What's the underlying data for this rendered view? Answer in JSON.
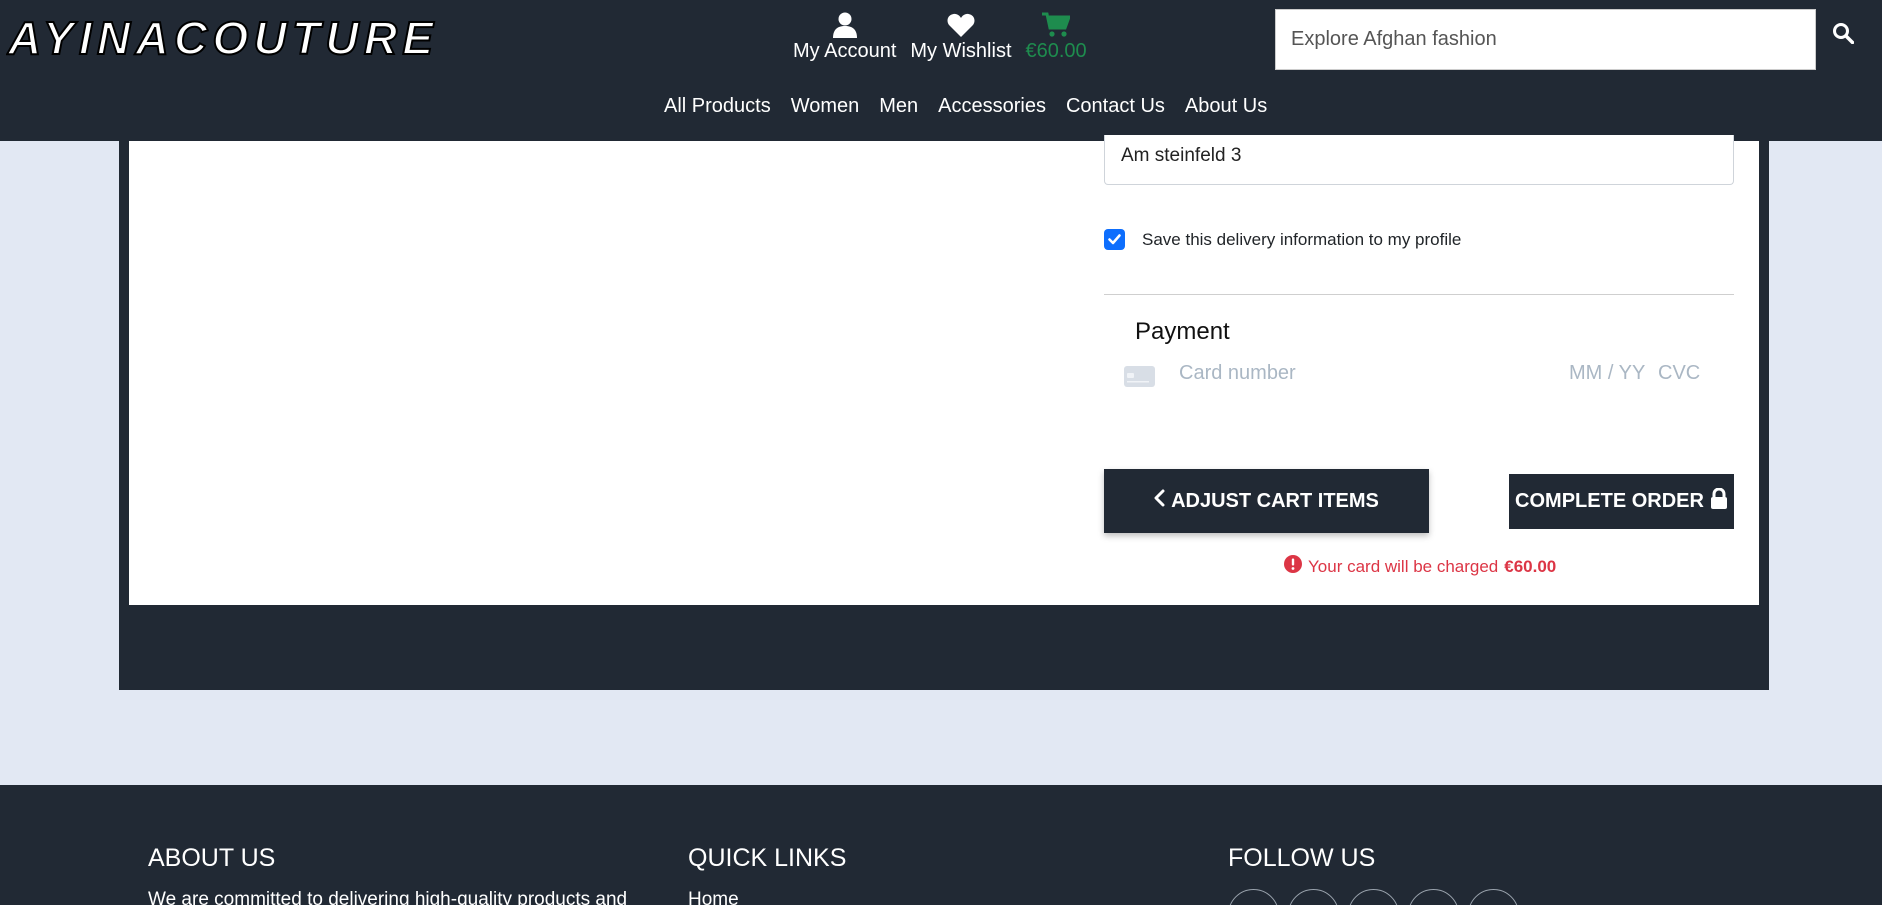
{
  "header": {
    "logo_text": "AYINACOUTURE",
    "account_label": "My Account",
    "wishlist_label": "My Wishlist",
    "cart_total": "€60.00",
    "search_placeholder": "Explore Afghan fashion"
  },
  "nav": {
    "items": [
      "All Products",
      "Women",
      "Men",
      "Accessories",
      "Contact Us",
      "About Us"
    ]
  },
  "checkout": {
    "address_value": "Am steinfeld 3",
    "save_info_label": "Save this delivery information to my profile",
    "save_info_checked": true,
    "payment_title": "Payment",
    "card_number_placeholder": "Card number",
    "expiry_placeholder": "MM / YY",
    "cvc_placeholder": "CVC",
    "adjust_button": "ADJUST CART ITEMS",
    "complete_button": "COMPLETE ORDER",
    "charge_notice": "Your card will be charged",
    "charge_amount": "€60.00"
  },
  "footer": {
    "about_title": "ABOUT US",
    "about_text": "We are committed to delivering high-quality products and",
    "links_title": "QUICK LINKS",
    "links_first": "Home",
    "follow_title": "FOLLOW US"
  },
  "colors": {
    "dark": "#212934",
    "cart_green": "#1e8c4e",
    "error_red": "#dc3545",
    "checkbox_blue": "#0d6efd",
    "page_bg": "#e2e8f3"
  },
  "icons": [
    "user-icon",
    "heart-icon",
    "cart-icon",
    "search-icon",
    "credit-card-icon",
    "chevron-left-icon",
    "lock-icon",
    "alert-circle-icon"
  ]
}
